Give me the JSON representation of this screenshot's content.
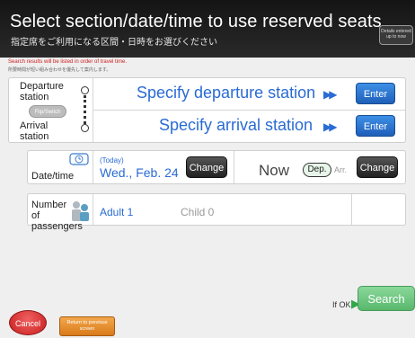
{
  "header": {
    "title": "Select section/date/time to use reserved seats",
    "subtitle": "指定席をご利用になる区間・日時をお選びください",
    "details_button": "Details entered up to now"
  },
  "notes": {
    "order": "Search results will be listed in order of travel time.",
    "order_ja": "所要時間が短い組み合わせを優先して案内します。"
  },
  "stations": {
    "departure_label": "Departure station",
    "arrival_label": "Arrival station",
    "swap_label": "Flip/Switch",
    "departure_prompt": "Specify departure station",
    "arrival_prompt": "Specify arrival station",
    "enter_label": "Enter"
  },
  "date": {
    "label": "Date/time",
    "today": "(Today)",
    "value": "Wed., Feb. 24",
    "change_label": "Change",
    "time_value": "Now",
    "dep_label": "Dep.",
    "arr_label": "Arr."
  },
  "passengers": {
    "label": "Number of passengers",
    "adult": "Adult 1",
    "child": "Child 0"
  },
  "footer": {
    "if_ok": "If OK",
    "search": "Search",
    "cancel": "Cancel",
    "return": "Return to previous screen"
  },
  "colors": {
    "accent_blue": "#2a6bd4",
    "search_green": "#58b86c",
    "cancel_red": "#c81e1e",
    "return_orange": "#d97b1a"
  }
}
